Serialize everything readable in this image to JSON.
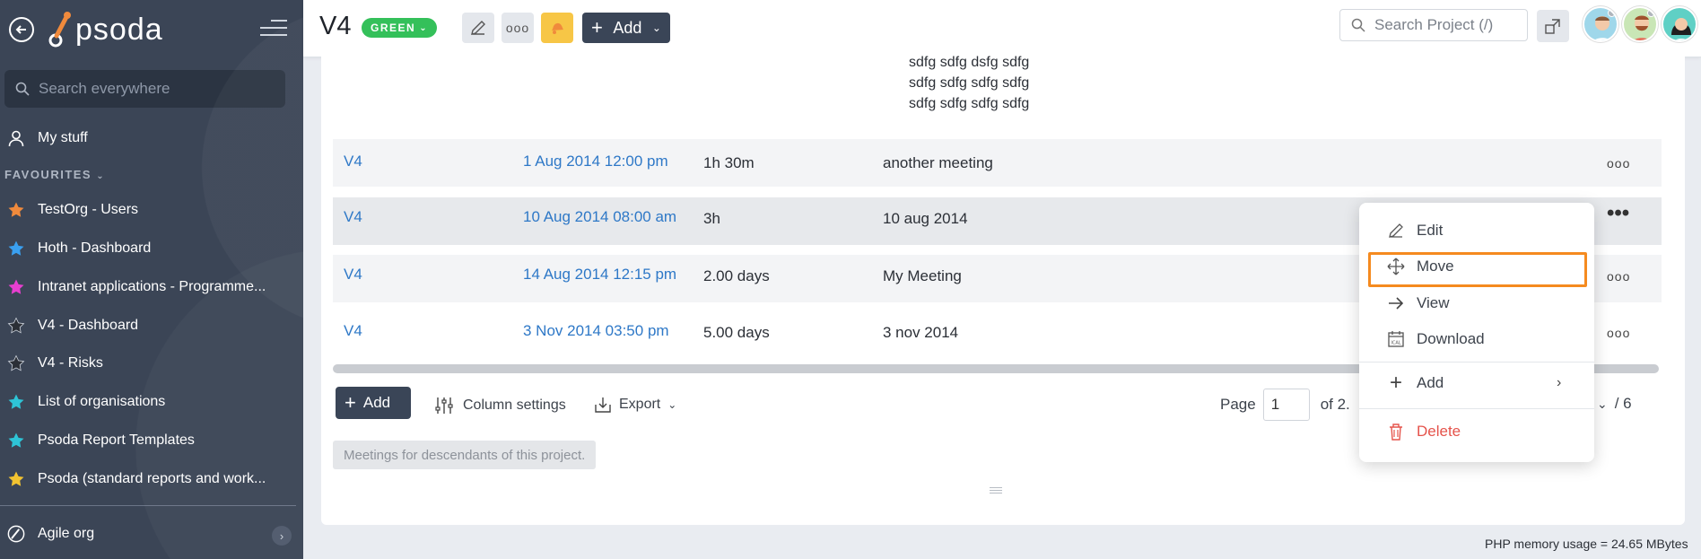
{
  "sidebar": {
    "logo_text": "psoda",
    "search_placeholder": "Search everywhere",
    "my_stuff": "My stuff",
    "favourites_heading": "FAVOURITES",
    "favourites": [
      {
        "label": "TestOrg - Users",
        "color": "#f08a3c"
      },
      {
        "label": "Hoth - Dashboard",
        "color": "#3aa0f0"
      },
      {
        "label": "Intranet applications - Programme...",
        "color": "#e83fd0"
      },
      {
        "label": "V4 - Dashboard",
        "color": "#2b2f36"
      },
      {
        "label": "V4 - Risks",
        "color": "#2b2f36"
      },
      {
        "label": "List of organisations",
        "color": "#2ec4d6"
      },
      {
        "label": "Psoda Report Templates",
        "color": "#2ec4d6"
      },
      {
        "label": "Psoda (standard reports and work...",
        "color": "#f2c331"
      }
    ],
    "org": "Agile org"
  },
  "header": {
    "title": "V4",
    "status": "GREEN",
    "add_label": "Add",
    "search_placeholder": "Search Project (/)"
  },
  "table": {
    "top_text_lines": [
      "sdfg sdfg dsfg sdfg",
      "sdfg sdfg sdfg sdfg",
      "sdfg sdfg sdfg sdfg"
    ],
    "rows": [
      {
        "project": "V4",
        "start": "1 Aug 2014 12:00 pm",
        "duration": "1h 30m",
        "title": "another meeting"
      },
      {
        "project": "V4",
        "start": "10 Aug 2014 08:00 am",
        "duration": "3h",
        "title": "10 aug 2014"
      },
      {
        "project": "V4",
        "start": "14 Aug 2014 12:15 pm",
        "duration": "2.00 days",
        "title": "My Meeting"
      },
      {
        "project": "V4",
        "start": "3 Nov 2014 03:50 pm",
        "duration": "5.00 days",
        "title": "3 nov 2014"
      }
    ]
  },
  "footer": {
    "add_label": "Add",
    "column_settings": "Column settings",
    "export": "Export",
    "page_label": "Page",
    "page_value": "1",
    "of_label": "of 2.",
    "per_page_suffix": "/ 6",
    "description": "Meetings for descendants of this project."
  },
  "context_menu": {
    "edit": "Edit",
    "move": "Move",
    "view": "View",
    "download": "Download",
    "add": "Add",
    "delete": "Delete"
  },
  "memory_usage": "PHP memory usage = 24.65 MBytes",
  "colors": {
    "sidebar_bg": "#3b4556",
    "accent_dark": "#3a4557",
    "link": "#2e78c7",
    "status_green": "#34c05a",
    "bell_yellow": "#f7c646",
    "highlight_orange": "#f58a1f",
    "delete_red": "#e5534b"
  }
}
